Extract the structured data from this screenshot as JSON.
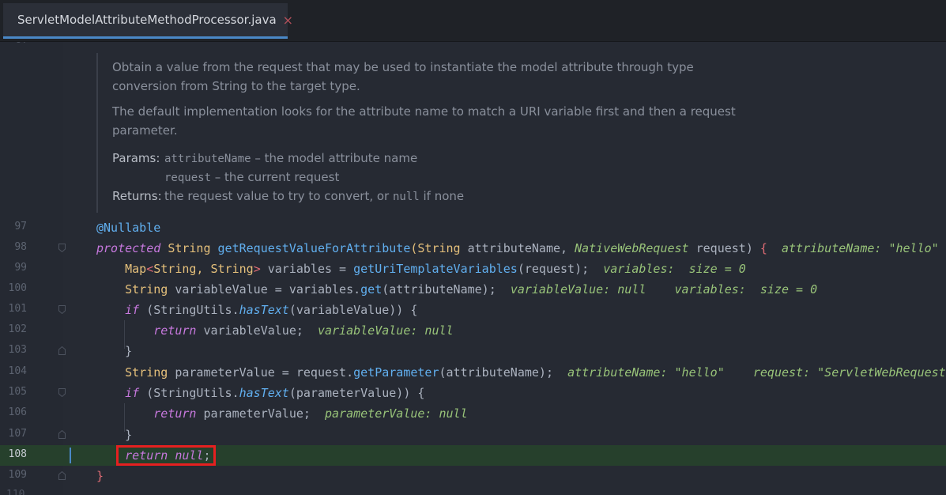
{
  "tab": {
    "label": "ServletModelAttributeMethodProcessor.java",
    "close_glyph": "×",
    "icon": "java-class-icon"
  },
  "gutter": {
    "partial_above": "97",
    "partial_below": "110"
  },
  "javadoc": {
    "paragraph1": "Obtain a value from the request that may be used to instantiate the model attribute through type conversion from String to the target type.",
    "paragraph2": "The default implementation looks for the attribute name to match a URI variable first and then a request parameter.",
    "params_label": "Params:",
    "params": [
      {
        "name": "attributeName",
        "desc": " – the model attribute name"
      },
      {
        "name": "request",
        "desc": " – the current request"
      }
    ],
    "returns_label": "Returns:",
    "returns_prefix": "the request value to try to convert, or ",
    "returns_code": "null",
    "returns_suffix": " if none"
  },
  "lines": {
    "l97": "97",
    "l98": "98",
    "l99": "99",
    "l100": "100",
    "l101": "101",
    "l102": "102",
    "l103": "103",
    "l104": "104",
    "l105": "105",
    "l106": "106",
    "l107": "107",
    "l108": "108",
    "l109": "109"
  },
  "code": {
    "annotation": "@Nullable",
    "protected_kw": "protected",
    "string_type": "String",
    "method_name": "getRequestValueForAttribute",
    "open_paren": "(",
    "param1_type": "String",
    "param1_name": " attributeName, ",
    "param2_type": "NativeWebRequest",
    "param2_name": " request) ",
    "open_brace": "{",
    "hint98": "attributeName: \"hello\"",
    "map_type": "Map",
    "generic_open": "<",
    "generic_args": "String, String",
    "generic_close": ">",
    "variables_assign": " variables = ",
    "get_uri": "getUriTemplateVariables",
    "request_arg": "(request);",
    "hint99a": "variables:",
    "hint99b": "size = 0",
    "variable_value_decl": " variableValue = variables.",
    "get_call": "get",
    "attr_name_arg": "(attributeName);",
    "hint100a": "variableValue: null",
    "hint100b": "variables:",
    "hint100c": "size = 0",
    "if_kw": "if",
    "string_utils": " (StringUtils.",
    "has_text": "hasText",
    "var_value_paren": "(variableValue)) {",
    "return_kw": "return",
    "return_var_value": " variableValue;",
    "hint102": "variableValue: null",
    "close_brace": "}",
    "param_value_decl": " parameterValue = request.",
    "get_parameter": "getParameter",
    "hint104a": "attributeName: \"hello\"",
    "hint104b": "request: \"ServletWebRequest",
    "param_value_paren": "(parameterValue)) {",
    "return_param_value": " parameterValue;",
    "hint106": "parameterValue: null",
    "return_null": "return null",
    "semicolon": ";",
    "method_close": "}"
  }
}
